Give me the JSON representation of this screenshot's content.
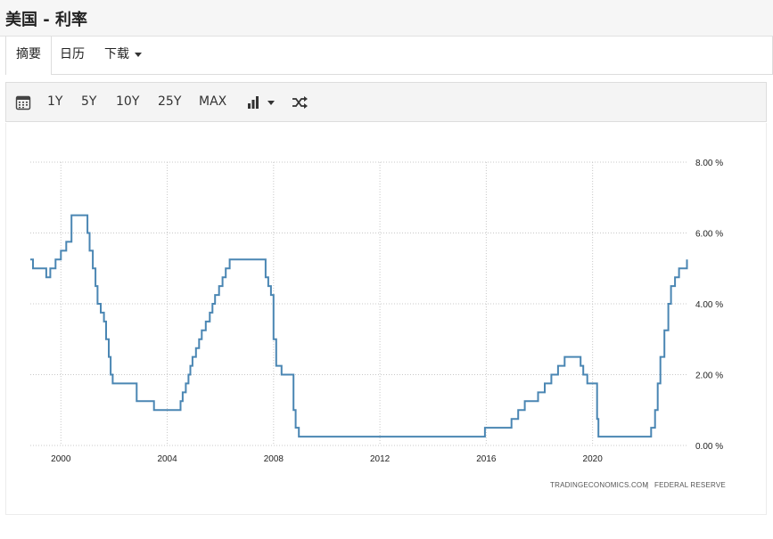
{
  "page": {
    "title": "美国 - 利率"
  },
  "tabs": [
    {
      "label": "摘要",
      "active": true
    },
    {
      "label": "日历",
      "active": false
    },
    {
      "label": "下载",
      "active": false,
      "icon": "caret-down-icon"
    }
  ],
  "toolbar": {
    "calendar_icon": "calendar-icon",
    "ranges": [
      "1Y",
      "5Y",
      "10Y",
      "25Y",
      "MAX"
    ],
    "chart_type_icon": "bar-chart-icon",
    "compare_icon": "shuffle-icon"
  },
  "source": {
    "site": "TRADINGECONOMICS.COM",
    "separator": "|",
    "org": "FEDERAL RESERVE"
  },
  "chart_data": {
    "type": "line",
    "line_style": "step",
    "color": "#4a86b3",
    "grid": true,
    "x_range": [
      1998.85,
      2023.6
    ],
    "ylim": [
      0,
      8
    ],
    "x_ticks": [
      "2000",
      "2004",
      "2008",
      "2012",
      "2016",
      "2020"
    ],
    "y_ticks": [
      "0.00 %",
      "2.00 %",
      "4.00 %",
      "6.00 %",
      "8.00 %"
    ],
    "series": [
      {
        "x": [
          1998.85,
          1998.95,
          1999.45,
          1999.6,
          1999.8,
          2000.0,
          2000.2,
          2000.4,
          2001.0,
          2001.08,
          2001.2,
          2001.3,
          2001.38,
          2001.5,
          2001.62,
          2001.7,
          2001.8,
          2001.87,
          2001.95,
          2002.85,
          2003.5,
          2004.5,
          2004.58,
          2004.7,
          2004.8,
          2004.87,
          2004.95,
          2005.08,
          2005.2,
          2005.3,
          2005.45,
          2005.6,
          2005.7,
          2005.8,
          2005.95,
          2006.08,
          2006.2,
          2006.35,
          2006.5,
          2007.7,
          2007.8,
          2007.9,
          2008.0,
          2008.1,
          2008.3,
          2008.75,
          2008.83,
          2008.95,
          2015.95,
          2016.95,
          2017.2,
          2017.45,
          2017.95,
          2018.2,
          2018.45,
          2018.7,
          2018.95,
          2019.55,
          2019.65,
          2019.8,
          2020.17,
          2020.22,
          2022.2,
          2022.35,
          2022.45,
          2022.55,
          2022.7,
          2022.85,
          2022.95,
          2023.1,
          2023.25,
          2023.55
        ],
        "y": [
          5.25,
          5.0,
          4.75,
          5.0,
          5.25,
          5.5,
          5.75,
          6.5,
          6.0,
          5.5,
          5.0,
          4.5,
          4.0,
          3.75,
          3.5,
          3.0,
          2.5,
          2.0,
          1.75,
          1.25,
          1.0,
          1.25,
          1.5,
          1.75,
          2.0,
          2.25,
          2.5,
          2.75,
          3.0,
          3.25,
          3.5,
          3.75,
          4.0,
          4.25,
          4.5,
          4.75,
          5.0,
          5.25,
          5.25,
          4.75,
          4.5,
          4.25,
          3.0,
          2.25,
          2.0,
          1.0,
          0.5,
          0.25,
          0.5,
          0.75,
          1.0,
          1.25,
          1.5,
          1.75,
          2.0,
          2.25,
          2.5,
          2.25,
          2.0,
          1.75,
          0.75,
          0.25,
          0.5,
          1.0,
          1.75,
          2.5,
          3.25,
          4.0,
          4.5,
          4.75,
          5.0,
          5.25
        ]
      }
    ]
  }
}
